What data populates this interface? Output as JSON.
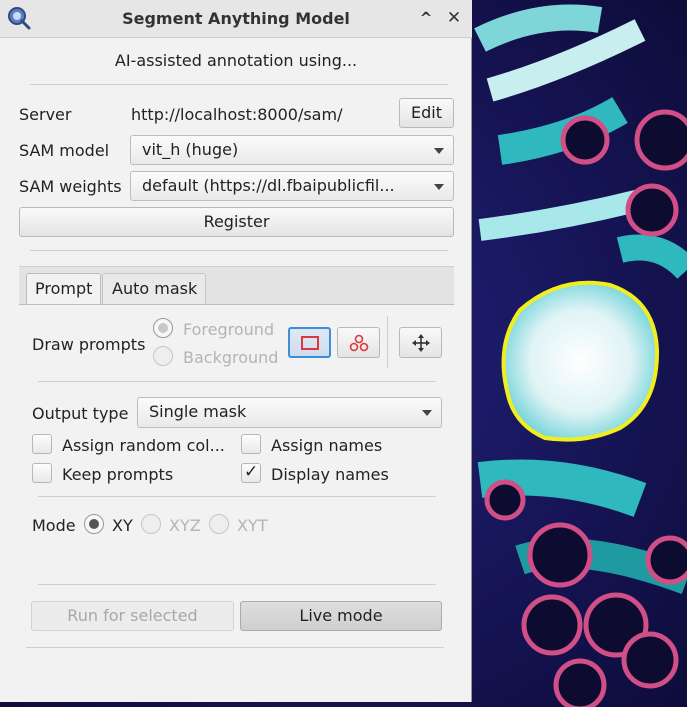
{
  "window": {
    "title": "Segment Anything Model",
    "subtitle": "AI-assisted annotation using...",
    "collapse_glyph": "^",
    "close_glyph": "✕",
    "app_icon": "magnifier-icon"
  },
  "server": {
    "label": "Server",
    "url": "http://localhost:8000/sam/",
    "edit_label": "Edit"
  },
  "sam_model": {
    "label": "SAM model",
    "value": "vit_h (huge)"
  },
  "sam_weights": {
    "label": "SAM weights",
    "value": "default (https://dl.fbaipublicfil..."
  },
  "register_label": "Register",
  "tabs": [
    {
      "label": "Prompt",
      "selected": true
    },
    {
      "label": "Auto mask",
      "selected": false
    }
  ],
  "prompt": {
    "draw_prompts_label": "Draw prompts",
    "foreground_label": "Foreground",
    "background_label": "Background",
    "foreground_selected": true,
    "rectangle_tool_icon": "rectangle-icon",
    "points_tool_icon": "points-icon",
    "move_tool_icon": "move-icon",
    "tool_accent_color": "#e0353a",
    "selected_tool_border": "#3c8fd6",
    "output_type_label": "Output type",
    "output_type_value": "Single mask",
    "assign_random_colors_label": "Assign random col...",
    "assign_random_colors_checked": false,
    "assign_names_label": "Assign names",
    "assign_names_checked": false,
    "keep_prompts_label": "Keep prompts",
    "keep_prompts_checked": false,
    "display_names_label": "Display names",
    "display_names_checked": true,
    "check_glyph": "✓",
    "mode_label": "Mode",
    "modes": [
      {
        "label": "XY",
        "selected": true,
        "enabled": true
      },
      {
        "label": "XYZ",
        "selected": false,
        "enabled": false
      },
      {
        "label": "XYT",
        "selected": false,
        "enabled": false
      }
    ],
    "run_for_selected_label": "Run for selected",
    "live_mode_label": "Live mode"
  },
  "colors": {
    "annotation_outline": "#f2ee1e",
    "dialog_background": "#f2f2f2"
  }
}
